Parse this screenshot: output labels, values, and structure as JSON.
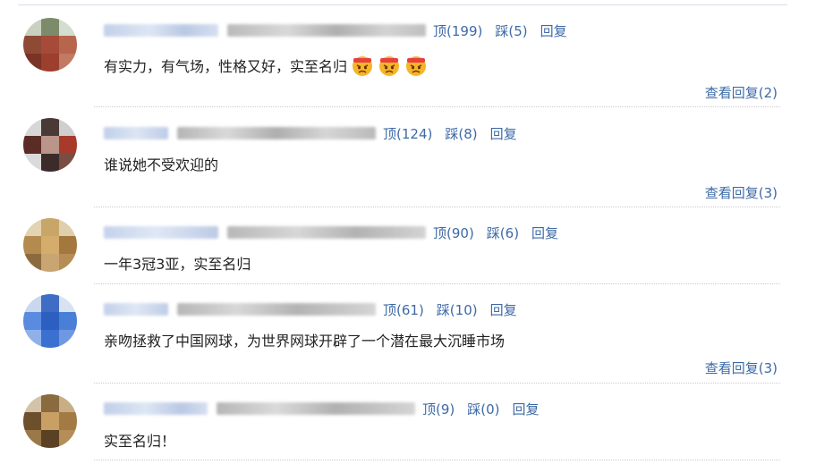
{
  "comments": [
    {
      "up_label": "顶(199)",
      "down_label": "踩(5)",
      "reply_label": "回复",
      "text": "有实力，有气场，性格又好，实至名归",
      "view_replies": "查看回复(2)",
      "emoji_icon": "angry-face-emoji-icon"
    },
    {
      "up_label": "顶(124)",
      "down_label": "踩(8)",
      "reply_label": "回复",
      "text": "谁说她不受欢迎的",
      "view_replies": "查看回复(3)"
    },
    {
      "up_label": "顶(90)",
      "down_label": "踩(6)",
      "reply_label": "回复",
      "text": "一年3冠3亚，实至名归",
      "view_replies": ""
    },
    {
      "up_label": "顶(61)",
      "down_label": "踩(10)",
      "reply_label": "回复",
      "text": "亲吻拯救了中国网球，为世界网球开辟了一个潜在最大沉睡市场",
      "view_replies": "查看回复(3)"
    },
    {
      "up_label": "顶(9)",
      "down_label": "踩(0)",
      "reply_label": "回复",
      "text": "实至名归！",
      "view_replies": ""
    }
  ],
  "colors": {
    "link": "#3d6aa6",
    "text": "#222222",
    "separator": "#cccccc"
  }
}
